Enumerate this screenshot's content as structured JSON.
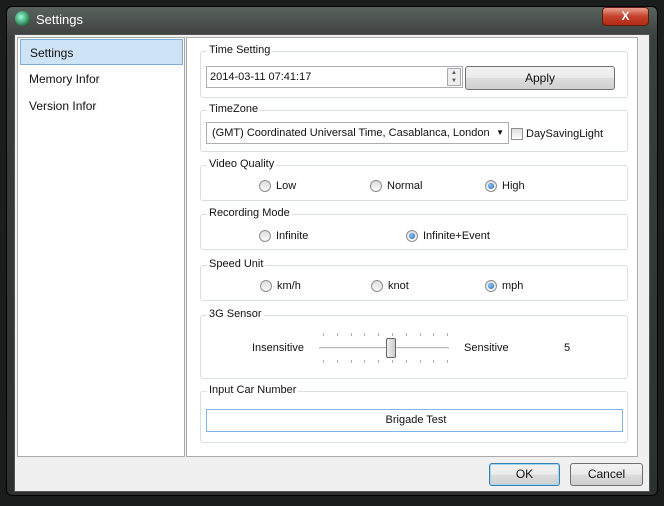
{
  "window": {
    "title": "Settings",
    "close_label": "X"
  },
  "sidebar": {
    "items": [
      {
        "label": "Settings",
        "selected": true
      },
      {
        "label": "Memory Infor"
      },
      {
        "label": "Version Infor"
      }
    ]
  },
  "time_setting": {
    "legend": "Time Setting",
    "value": "2014-03-11 07:41:17",
    "apply_label": "Apply"
  },
  "timezone": {
    "legend": "TimeZone",
    "selected": "(GMT) Coordinated Universal Time, Casablanca, London",
    "dst_label": "DaySavingLight",
    "dst_checked": false
  },
  "video_quality": {
    "legend": "Video Quality",
    "options": [
      "Low",
      "Normal",
      "High"
    ],
    "selected": "High"
  },
  "recording_mode": {
    "legend": "Recording Mode",
    "options": [
      "Infinite",
      "Infinite+Event"
    ],
    "selected": "Infinite+Event"
  },
  "speed_unit": {
    "legend": "Speed Unit",
    "options": [
      "km/h",
      "knot",
      "mph"
    ],
    "selected": "mph"
  },
  "sensor": {
    "legend": "3G Sensor",
    "min_label": "Insensitive",
    "max_label": "Sensitive",
    "value": "5"
  },
  "car_number": {
    "legend": "Input Car Number",
    "value": "Brigade Test"
  },
  "footer": {
    "ok_label": "OK",
    "cancel_label": "Cancel"
  },
  "colors": {
    "selection": "#cfe3f6",
    "close": "#c4412b"
  }
}
